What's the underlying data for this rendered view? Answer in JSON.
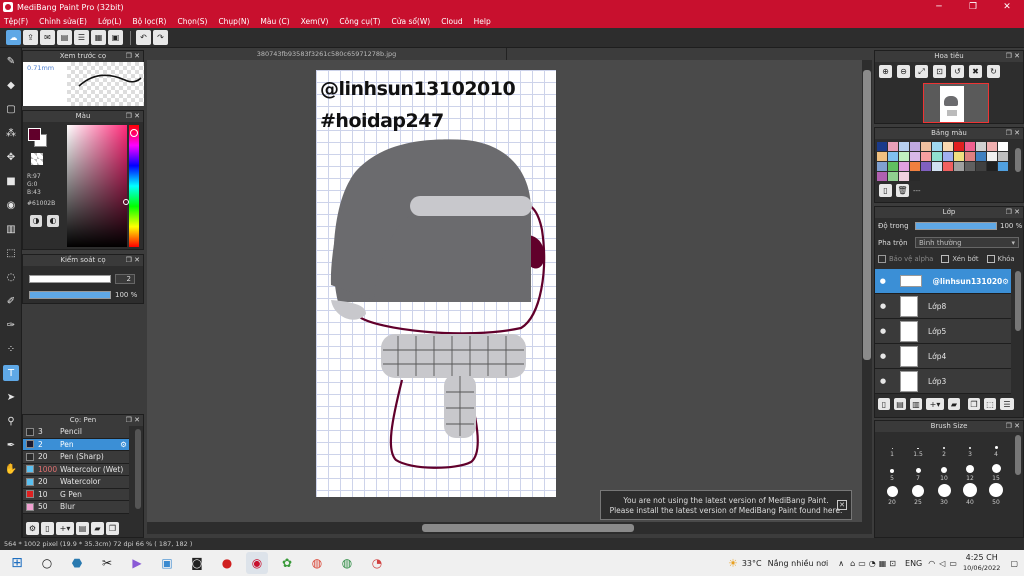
{
  "app": {
    "title": "MediBang Paint Pro (32bit)"
  },
  "window": {
    "minimize": "─",
    "maximize": "❐",
    "close": "✕"
  },
  "menu": [
    "Tệp(F)",
    "Chỉnh sửa(E)",
    "Lớp(L)",
    "Bộ lọc(R)",
    "Chọn(S)",
    "Chụp(N)",
    "Màu (C)",
    "Xem(V)",
    "Công cụ(T)",
    "Cửa sổ(W)",
    "Cloud",
    "Help"
  ],
  "document": {
    "tab_name": "380743fb93583f3261c580c65971278b.jpg",
    "watermark1": "@linhsun13102010",
    "watermark2": "#hoidap247"
  },
  "preview": {
    "title": "Xem trước cọ",
    "size_text": "0.71mm"
  },
  "color": {
    "title": "Màu",
    "r": "R:97",
    "g": "G:0",
    "b": "B:43",
    "hex": "#61002B"
  },
  "brush_control": {
    "title": "Kiểm soát cọ",
    "size": "2",
    "opacity": "100 %"
  },
  "brush_panel": {
    "title": "Cọ: Pen",
    "items": [
      {
        "size": "3",
        "name": "Pencil",
        "color": "#2b2b2b"
      },
      {
        "size": "2",
        "name": "Pen",
        "color": "#1a1a2e"
      },
      {
        "size": "20",
        "name": "Pen (Sharp)",
        "color": "#2b2b2b"
      },
      {
        "size": "1000",
        "name": "Watercolor (Wet)",
        "color": "#5bc0f0"
      },
      {
        "size": "20",
        "name": "Watercolor",
        "color": "#5bc0f0"
      },
      {
        "size": "10",
        "name": "G Pen",
        "color": "#e02020"
      },
      {
        "size": "50",
        "name": "Blur",
        "color": "#f0a0d0"
      }
    ]
  },
  "navigator": {
    "title": "Hoa tiêu"
  },
  "palette": {
    "title": "Bảng màu",
    "dash": "---"
  },
  "layer_panel": {
    "title": "Lớp",
    "opacity_label": "Độ trong",
    "opacity_value": "100 %",
    "blend_label": "Pha trộn",
    "blend_value": "Bình thường",
    "protect_alpha": "Bảo vệ alpha",
    "clipping": "Xén bớt",
    "lock": "Khóa",
    "layers": [
      "@linhsun131020",
      "Lớp8",
      "Lớp5",
      "Lớp4",
      "Lớp3"
    ]
  },
  "brush_size": {
    "title": "Brush Size",
    "sizes": [
      "1",
      "1.5",
      "2",
      "3",
      "4",
      "5",
      "7",
      "10",
      "12",
      "15",
      "20",
      "25",
      "30",
      "40",
      "50"
    ]
  },
  "notification": {
    "line1": "You are not using the latest version of MediBang Paint.",
    "line2": "Please install the latest version of MediBang Paint found here."
  },
  "status": {
    "text": "564 * 1002 pixel   (19.9 * 35.3cm)   72 dpi   66 %   ( 187, 182 )"
  },
  "taskbar": {
    "temp": "33°C",
    "weather": "Nắng nhiều nơi",
    "lang": "ENG",
    "time": "4:25 CH",
    "date": "10/06/2022"
  },
  "colors": {
    "accent": "#c8102e",
    "current_color": "#61002B",
    "selection": "#3b8fd6",
    "hat": "#6b6b6e",
    "hat_band": "#c8c8cc",
    "scarf": "#c8c8cc",
    "outline": "#61002B"
  }
}
